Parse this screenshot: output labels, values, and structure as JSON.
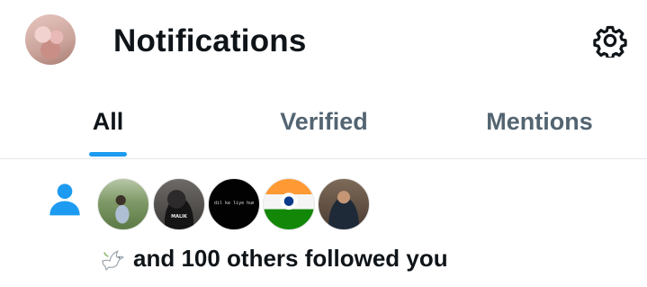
{
  "header": {
    "title": "Notifications",
    "settings_icon": "gear-icon"
  },
  "tabs": [
    {
      "label": "All",
      "active": true
    },
    {
      "label": "Verified",
      "active": false
    },
    {
      "label": "Mentions",
      "active": false
    }
  ],
  "colors": {
    "accent": "#1d9bf0",
    "text_primary": "#0f1419",
    "text_secondary": "#536471"
  },
  "notification": {
    "type_icon": "person-icon",
    "followers": [
      {
        "avatar": "avatar-1",
        "overlay_text": ""
      },
      {
        "avatar": "avatar-2",
        "overlay_text": "MALIK"
      },
      {
        "avatar": "avatar-3",
        "overlay_text": "dil ke liye hum kush bhi"
      },
      {
        "avatar": "avatar-4",
        "overlay_text": ""
      },
      {
        "avatar": "avatar-5",
        "overlay_text": ""
      }
    ],
    "name_icon": "dove-icon",
    "message": "and 100 others followed you"
  }
}
